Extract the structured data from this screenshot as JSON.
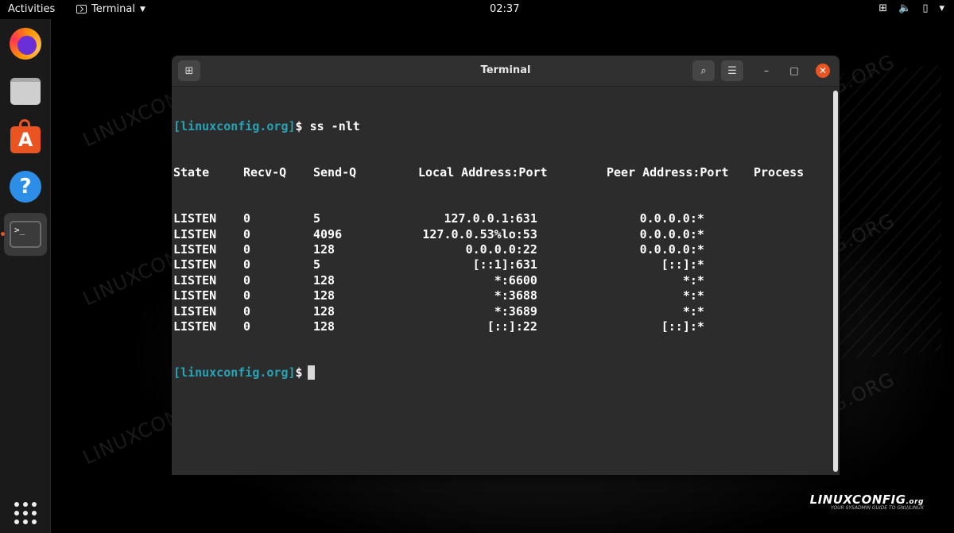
{
  "topbar": {
    "activities": "Activities",
    "app_menu": "Terminal",
    "clock": "02:37",
    "tray": {
      "network_icon": "⊞",
      "volume_icon": "🔈",
      "battery_icon": "▯",
      "menu_caret": "▾"
    }
  },
  "dock": {
    "items": [
      "firefox",
      "files",
      "software",
      "help",
      "terminal"
    ],
    "terminal_prompt": ">_"
  },
  "window": {
    "title": "Terminal",
    "new_tab_icon": "⊞",
    "search_icon": "⌕",
    "menu_icon": "☰",
    "minimize": "–",
    "maximize": "□",
    "close": "✕"
  },
  "terminal": {
    "prompt": "[linuxconfig.org]",
    "dollar": "$",
    "command": "ss -nlt",
    "headers": {
      "state": "State",
      "recvq": "Recv-Q",
      "sendq": "Send-Q",
      "local": "Local Address:Port",
      "peer": "Peer Address:Port",
      "process": "Process"
    },
    "rows": [
      {
        "state": "LISTEN",
        "recvq": "0",
        "sendq": "5",
        "local": "127.0.0.1:631",
        "peer": "0.0.0.0:*"
      },
      {
        "state": "LISTEN",
        "recvq": "0",
        "sendq": "4096",
        "local": "127.0.0.53%lo:53",
        "peer": "0.0.0.0:*"
      },
      {
        "state": "LISTEN",
        "recvq": "0",
        "sendq": "128",
        "local": "0.0.0.0:22",
        "peer": "0.0.0.0:*"
      },
      {
        "state": "LISTEN",
        "recvq": "0",
        "sendq": "5",
        "local": "[::1]:631",
        "peer": "[::]:*"
      },
      {
        "state": "LISTEN",
        "recvq": "0",
        "sendq": "128",
        "local": "*:6600",
        "peer": "*:*"
      },
      {
        "state": "LISTEN",
        "recvq": "0",
        "sendq": "128",
        "local": "*:3688",
        "peer": "*:*"
      },
      {
        "state": "LISTEN",
        "recvq": "0",
        "sendq": "128",
        "local": "*:3689",
        "peer": "*:*"
      },
      {
        "state": "LISTEN",
        "recvq": "0",
        "sendq": "128",
        "local": "[::]:22",
        "peer": "[::]:*"
      }
    ]
  },
  "watermark": "LINUXCONFIG.ORG",
  "logo": {
    "brand": "LINUXCONFIG",
    "suffix": ".org",
    "tagline": "YOUR SYSADMIN GUIDE TO GNU/LINUX"
  },
  "colors": {
    "accent": "#e95420",
    "prompt": "#26a3b5",
    "terminal_bg": "#2c2c2c"
  }
}
